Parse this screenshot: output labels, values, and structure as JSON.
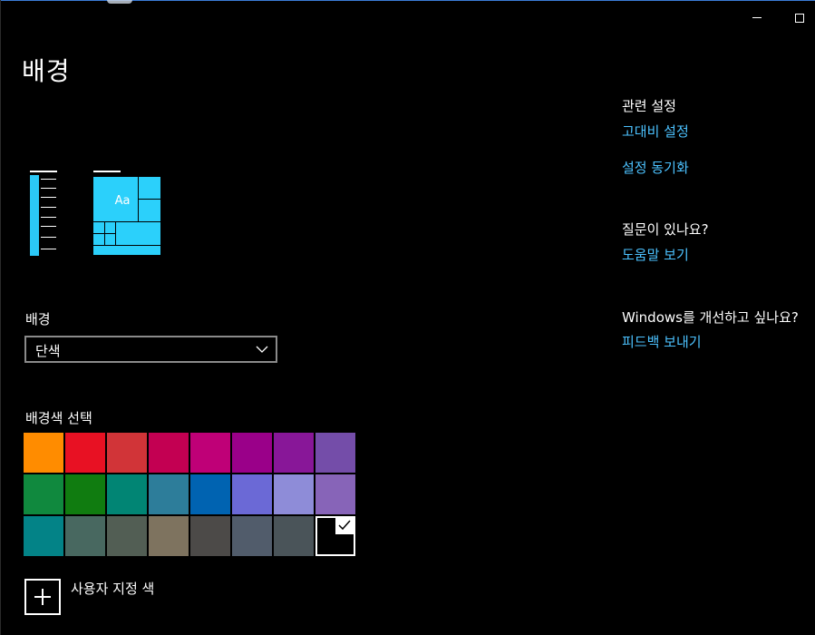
{
  "window": {
    "minimize": "minimize",
    "maximize": "maximize"
  },
  "page": {
    "title": "배경"
  },
  "preview": {
    "sample_text": "Aa"
  },
  "background": {
    "label": "배경",
    "dropdown_value": "단색"
  },
  "color_picker": {
    "label": "배경색 선택",
    "colors": [
      "#ff8c00",
      "#e81123",
      "#d13438",
      "#c30052",
      "#bf0077",
      "#9a0089",
      "#881798",
      "#744da9",
      "#10893e",
      "#107c10",
      "#018574",
      "#2d7d9a",
      "#0063b1",
      "#6b69d6",
      "#8e8cd8",
      "#8764b8",
      "#038387",
      "#486860",
      "#525e54",
      "#7e735f",
      "#4c4a48",
      "#515c6b",
      "#4a5459",
      "#000000"
    ],
    "selected_index": 23,
    "custom_label": "사용자 지정 색"
  },
  "related": {
    "heading": "관련 설정",
    "link1": "고대비 설정",
    "link2": "설정 동기화"
  },
  "help": {
    "heading": "질문이 있나요?",
    "link": "도움말 보기"
  },
  "feedback": {
    "heading": "Windows를 개선하고 싶나요?",
    "link": "피드백 보내기"
  }
}
